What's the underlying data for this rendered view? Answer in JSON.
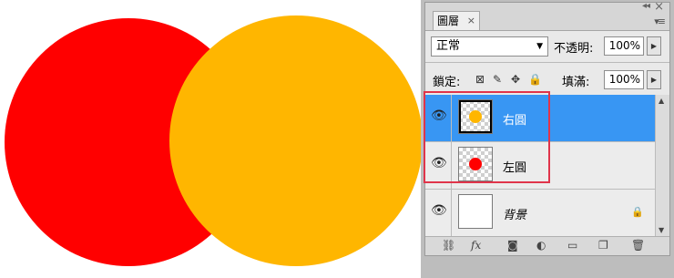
{
  "canvas": {
    "circle_left_color": "#ff0000",
    "circle_right_color": "#ffb600"
  },
  "panel": {
    "tab_label": "圖層",
    "tab_close": "×",
    "close_symbol": "×",
    "collapse_symbol": "◂◂",
    "menu_icon": "▾≡",
    "blend_mode": "正常",
    "opacity_label": "不透明:",
    "opacity_value": "100%",
    "lock_label": "鎖定:",
    "fill_label": "填滿:",
    "fill_value": "100%"
  },
  "layers": [
    {
      "name": "右圓",
      "thumb_color": "#ffb600",
      "selected": true,
      "visible": true
    },
    {
      "name": "左圓",
      "thumb_color": "#ff0000",
      "selected": false,
      "visible": true
    },
    {
      "name": "背景",
      "thumb_color": "#ffffff",
      "selected": false,
      "visible": true,
      "locked": true
    }
  ],
  "icons": {
    "eye": "visibility-eye-icon",
    "lock": "lock-icon",
    "lock_transparent": "lock-transparent-pixels-icon",
    "lock_paint": "lock-image-pixels-icon",
    "lock_move": "lock-position-icon",
    "lock_all": "lock-all-icon",
    "bottom": [
      "link-icon",
      "fx-icon",
      "mask-icon",
      "adjustment-icon",
      "folder-icon",
      "new-layer-icon",
      "trash-icon"
    ]
  },
  "highlight_color": "#e0344a"
}
